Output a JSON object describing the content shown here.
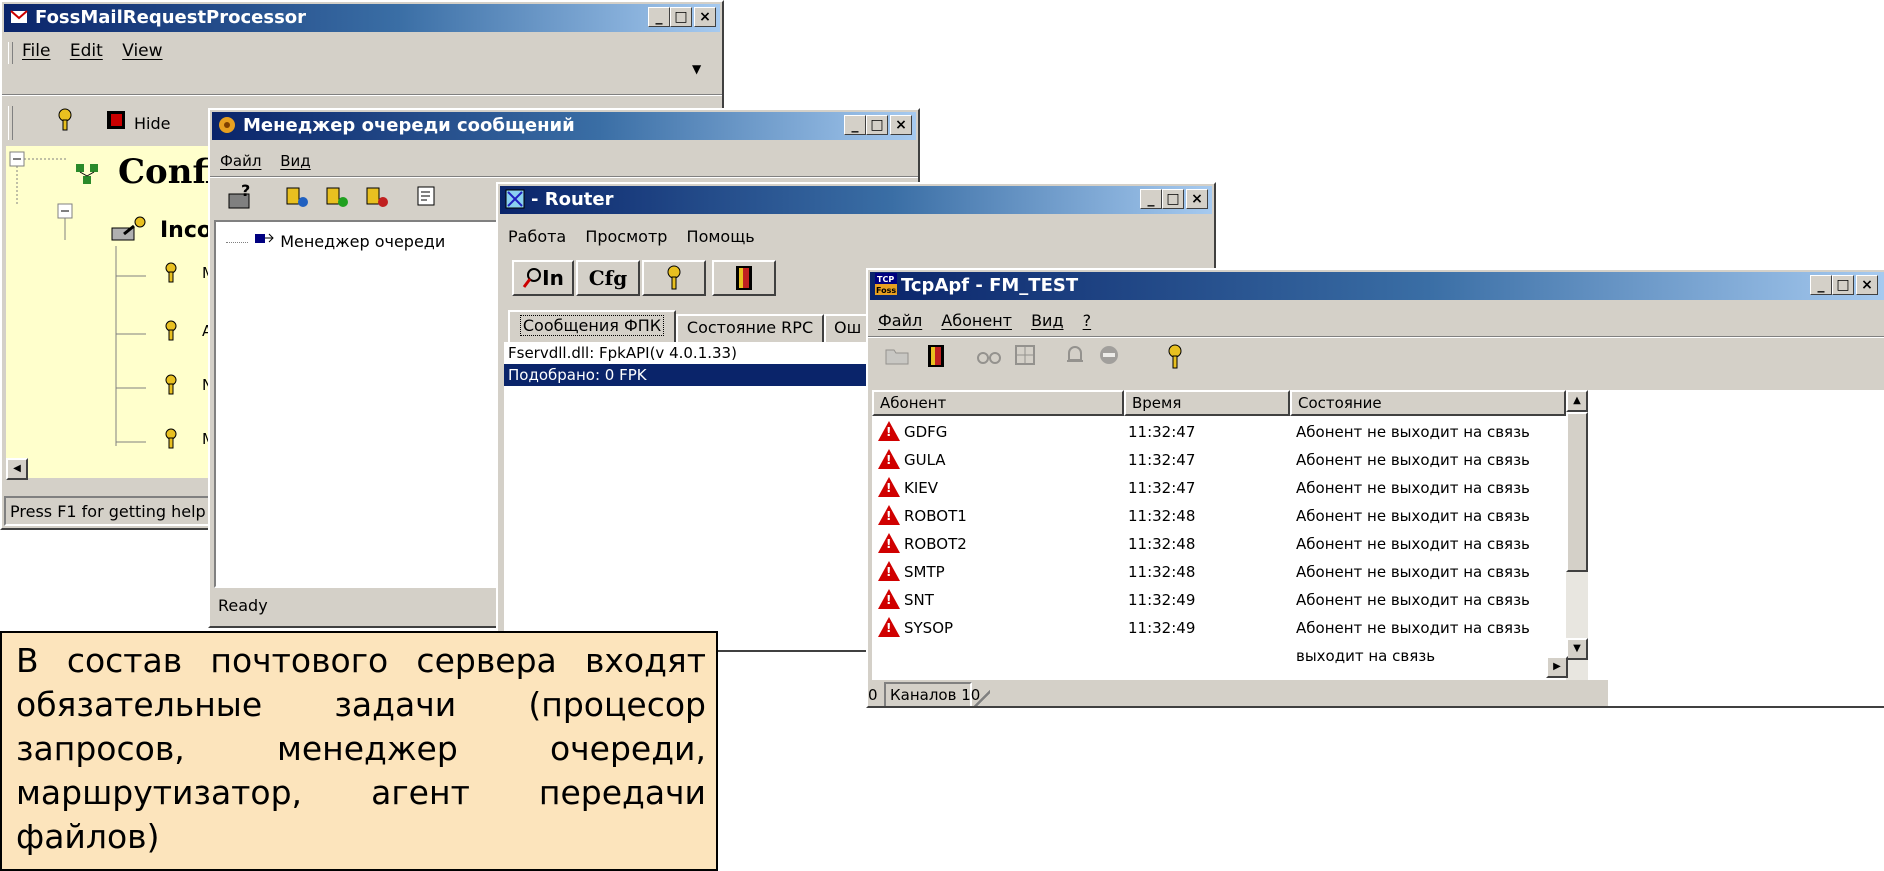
{
  "win1": {
    "title": "FossMailRequestProcessor",
    "menu": [
      "File",
      "Edit",
      "View"
    ],
    "hide_label": "Hide",
    "tree_root": "Confi",
    "tree_child": "Incor",
    "tree_leaf_letters": [
      "M",
      "A",
      "N",
      "M"
    ],
    "status": "Press F1 for getting help"
  },
  "win2": {
    "title": "Менеджер очереди сообщений",
    "menu": [
      "Файл",
      "Вид"
    ],
    "tree_item": "Менеджер очереди",
    "status": "Ready"
  },
  "win3": {
    "title": "- Router",
    "menu": [
      "Работа",
      "Просмотр",
      "Помощь"
    ],
    "btn_in": "In",
    "btn_cfg": "Cfg",
    "tabs": [
      "Сообщения ФПК",
      "Состояние RPC",
      "Ош"
    ],
    "lines": [
      "Fservdll.dll: FpkAPI(v 4.0.1.33)",
      "Подобрано: 0 FPK"
    ]
  },
  "win4": {
    "title": "TcpApf - FM_TEST",
    "menu": [
      "Файл",
      "Абонент",
      "Вид",
      "?"
    ],
    "columns": [
      "Абонент",
      "Время",
      "Состояние"
    ],
    "rows": [
      {
        "name": "GDFG",
        "time": "11:32:47",
        "state": "Абонент не выходит на связь"
      },
      {
        "name": "GULA",
        "time": "11:32:47",
        "state": "Абонент не выходит на связь"
      },
      {
        "name": "KIEV",
        "time": "11:32:47",
        "state": "Абонент не выходит на связь"
      },
      {
        "name": "ROBOT1",
        "time": "11:32:48",
        "state": "Абонент не выходит на связь"
      },
      {
        "name": "ROBOT2",
        "time": "11:32:48",
        "state": "Абонент не выходит на связь"
      },
      {
        "name": "SMTP",
        "time": "11:32:48",
        "state": "Абонент не выходит на связь"
      },
      {
        "name": "SNT",
        "time": "11:32:49",
        "state": "Абонент не выходит на связь"
      },
      {
        "name": "SYSOP",
        "time": "11:32:49",
        "state": "Абонент не выходит на связь"
      },
      {
        "name": "",
        "time": "",
        "state": "выходит на связь"
      }
    ],
    "status_left": "0",
    "status_right": "Каналов 10"
  },
  "caption": "В состав почтового сервера входят обязательные задачи (процесор запросов, менеджер очереди, маршрутизатор, агент передачи файлов)"
}
